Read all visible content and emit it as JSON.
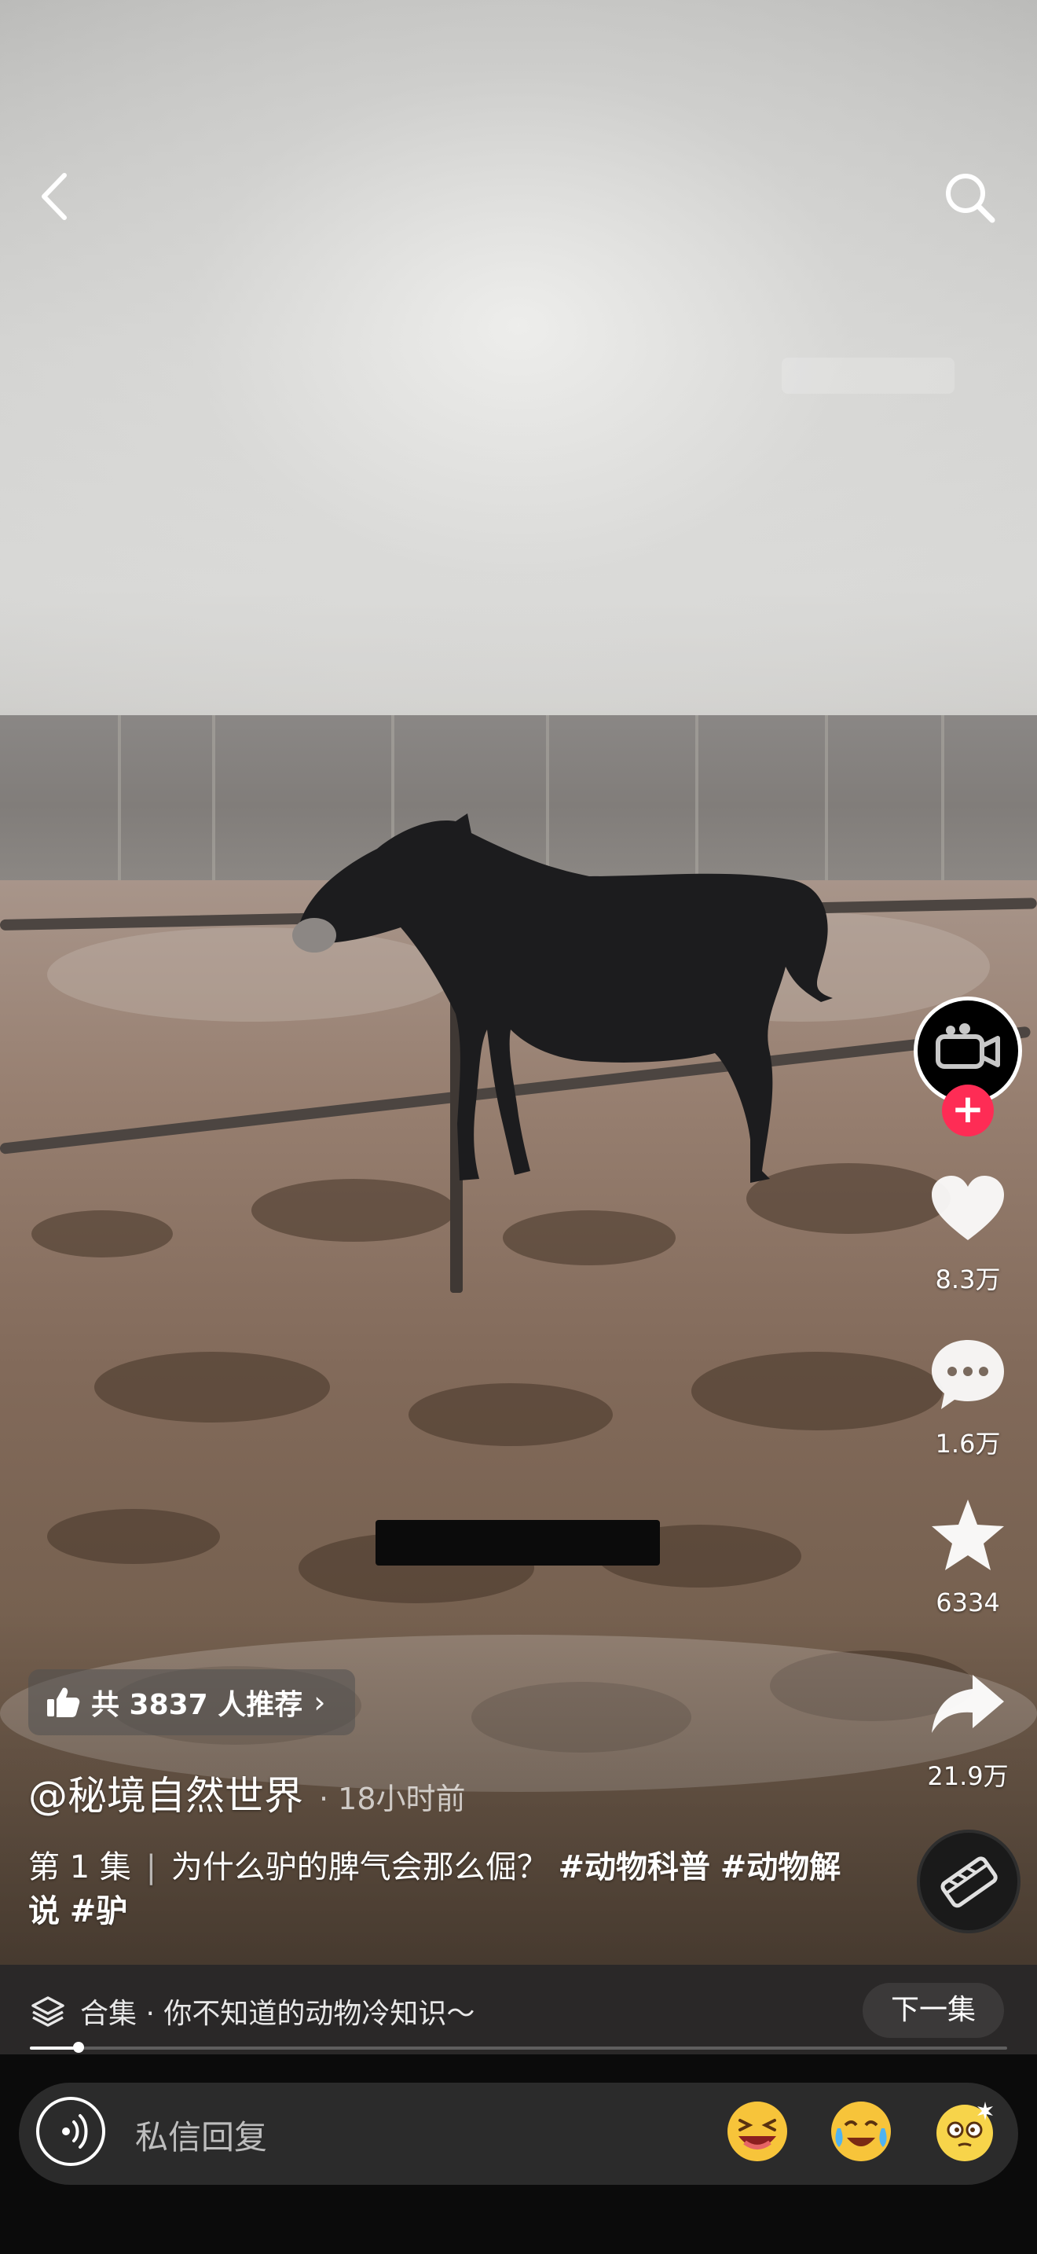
{
  "top_bar": {
    "back_icon": "chevron-left-icon",
    "search_icon": "search-icon"
  },
  "right_rail": {
    "avatar_icon": "video-camera-icon",
    "follow_icon": "plus-icon",
    "like": {
      "icon": "heart-icon",
      "count": "8.3万"
    },
    "comment": {
      "icon": "comment-bubble-icon",
      "count": "1.6万"
    },
    "favorite": {
      "icon": "star-icon",
      "count": "6334"
    },
    "share": {
      "icon": "share-arrow-icon",
      "count": "21.9万"
    },
    "music_icon": "music-disc-icon"
  },
  "recommend": {
    "icon": "thumbs-up-icon",
    "text": "共 3837 人推荐",
    "chevron": "›"
  },
  "post": {
    "author": "@秘境自然世界",
    "time": "· 18小时前",
    "caption_part1": "第 1 集",
    "caption_sep": "|",
    "caption_part2": "为什么驴的脾气会那么倔？",
    "tag1": "#动物科普",
    "tag2": "#动物解说",
    "tag3": "#驴"
  },
  "collection": {
    "icon": "layers-icon",
    "text": "合集 · 你不知道的动物冷知识～",
    "next_label": "下一集",
    "progress": 0.05
  },
  "input": {
    "voice_icon": "voice-icon",
    "placeholder": "私信回复",
    "emojis": [
      "squinting-laugh-emoji",
      "crying-laugh-emoji",
      "dizzy-emoji"
    ]
  },
  "colors": {
    "accent": "#fe2c55",
    "collection_bar": "#2a2828",
    "input_bar": "#2b2b2b"
  }
}
